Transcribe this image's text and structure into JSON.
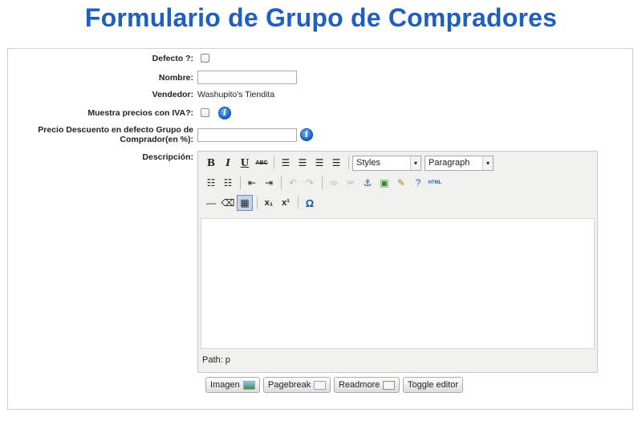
{
  "page": {
    "title": "Formulario de Grupo de Compradores"
  },
  "form": {
    "default_label": "Defecto ?:",
    "name_label": "Nombre:",
    "name_value": "",
    "vendor_label": "Vendedor:",
    "vendor_value": "Washupito's Tiendita",
    "show_prices_vat_label": "Muestra precios con IVA?:",
    "discount_label_line1": "Precio Descuento en defecto Grupo de",
    "discount_label_line2": "Comprador(en %):",
    "discount_value": "",
    "description_label": "Descripción:"
  },
  "editor": {
    "toolbar": {
      "bold": "B",
      "italic": "I",
      "underline": "U",
      "strike": "ABC",
      "styles_select": "Styles",
      "paragraph_select": "Paragraph",
      "html_button": "HTML",
      "subscript": "x₁",
      "superscript": "x¹",
      "charmap": "Ω"
    },
    "path_label": "Path: p"
  },
  "buttons": {
    "image": "Imagen",
    "pagebreak": "Pagebreak",
    "readmore": "Readmore",
    "toggle_editor": "Toggle editor"
  },
  "colors": {
    "title": "#1f5fc0",
    "info_icon": "#1461c9"
  }
}
